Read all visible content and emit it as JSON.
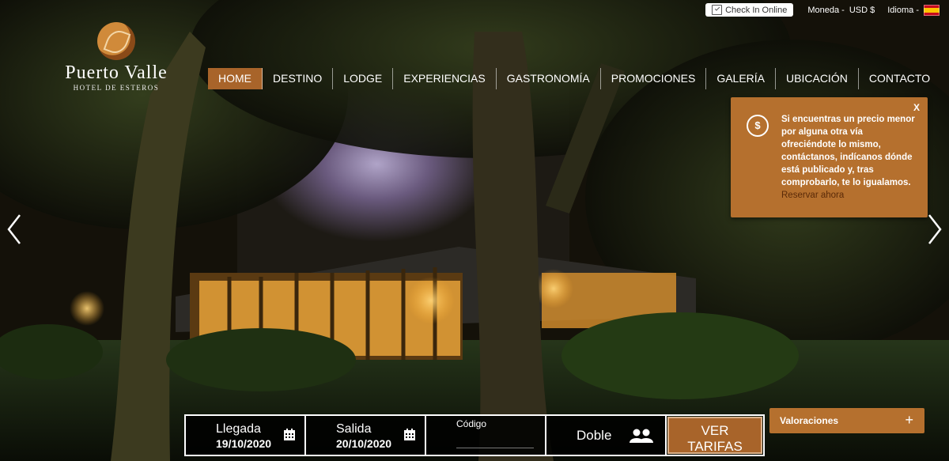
{
  "topbar": {
    "checkin": "Check In Online",
    "currency_label": "Moneda -",
    "currency": "USD $",
    "language_label": "Idioma -",
    "flag_icon": "spain-flag-icon"
  },
  "logo": {
    "name": "Puerto Valle",
    "subtitle": "HOTEL DE ESTEROS"
  },
  "nav": {
    "items": [
      "HOME",
      "DESTINO",
      "LODGE",
      "EXPERIENCIAS",
      "GASTRONOMÍA",
      "PROMOCIONES",
      "GALERÍA",
      "UBICACIÓN",
      "CONTACTO"
    ],
    "active": "HOME"
  },
  "promo": {
    "close": "X",
    "icon": "$",
    "text": "Si encuentras un precio menor por alguna otra vía ofreciéndote lo mismo, contáctanos, indícanos dónde está publicado y, tras comprobarlo, te lo igualamos.",
    "link": "Reservar ahora"
  },
  "booking": {
    "arrival_label": "Llegada",
    "arrival_value": "19/10/2020",
    "departure_label": "Salida",
    "departure_value": "20/10/2020",
    "code_label": "Código",
    "guests": "Doble",
    "cta_line1": "VER",
    "cta_line2": "TARIFAS"
  },
  "reviews": {
    "label": "Valoraciones",
    "toggle": "+"
  },
  "colors": {
    "accent": "#a8642a",
    "promo_bg": "#b5702e",
    "flag_red": "#c60b1e",
    "flag_yellow": "#ffc400"
  }
}
